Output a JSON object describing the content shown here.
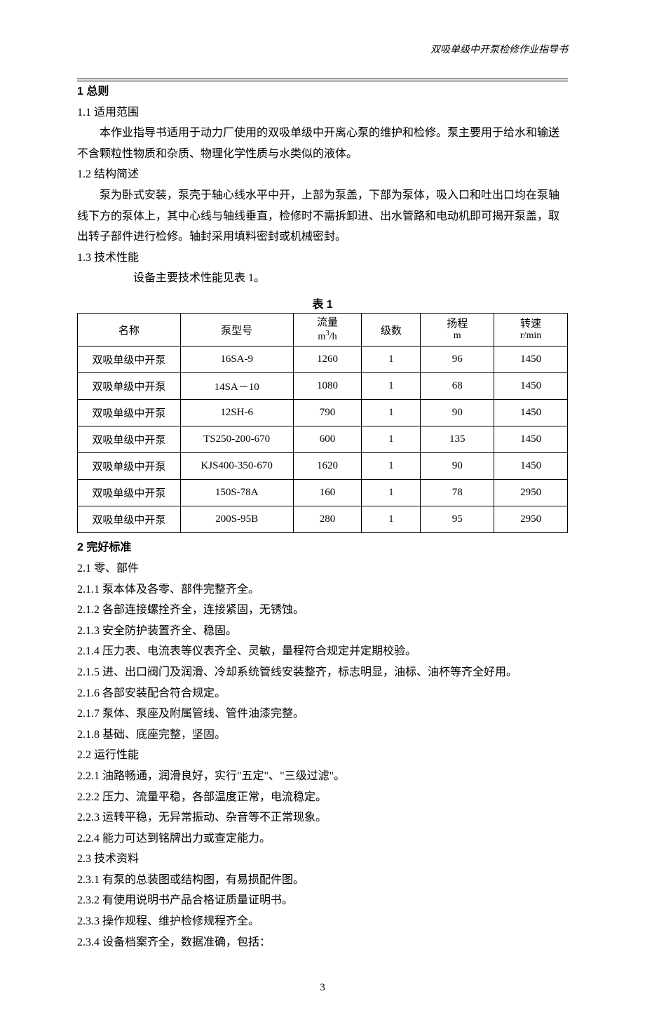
{
  "page_header": "双吸单级中开泵检修作业指导书",
  "sec1_title": "1  总则",
  "sec1_1_head": "1.1  适用范围",
  "sec1_1_p": "本作业指导书适用于动力厂使用的双吸单级中开离心泵的维护和检修。泵主要用于给水和输送不含颗粒性物质和杂质、物理化学性质与水类似的液体。",
  "sec1_2_head": "1.2  结构简述",
  "sec1_2_p": "泵为卧式安装，泵壳于轴心线水平中开，上部为泵盖，下部为泵体，吸入口和吐出口均在泵轴线下方的泵体上，其中心线与轴线垂直，检修时不需拆卸进、出水管路和电动机即可揭开泵盖，取出转子部件进行检修。轴封采用填料密封或机械密封。",
  "sec1_3_head": "1.3  技术性能",
  "sec1_3_p": "设备主要技术性能见表 1。",
  "table_caption": "表 1",
  "table": {
    "headers": {
      "name": "名称",
      "model": "泵型号",
      "flow_l1": "流量",
      "flow_l2_a": "m",
      "flow_l2_sup": "3",
      "flow_l2_b": "/h",
      "stages": "级数",
      "head_l1": "扬程",
      "head_l2": "m",
      "speed_l1": "转速",
      "speed_l2": "r/min"
    },
    "rows": [
      {
        "name": "双吸单级中开泵",
        "model": "16SA-9",
        "flow": "1260",
        "stages": "1",
        "head": "96",
        "speed": "1450"
      },
      {
        "name": "双吸单级中开泵",
        "model": "14SA－10",
        "flow": "1080",
        "stages": "1",
        "head": "68",
        "speed": "1450"
      },
      {
        "name": "双吸单级中开泵",
        "model": "12SH-6",
        "flow": "790",
        "stages": "1",
        "head": "90",
        "speed": "1450"
      },
      {
        "name": "双吸单级中开泵",
        "model": "TS250-200-670",
        "flow": "600",
        "stages": "1",
        "head": "135",
        "speed": "1450"
      },
      {
        "name": "双吸单级中开泵",
        "model": "KJS400-350-670",
        "flow": "1620",
        "stages": "1",
        "head": "90",
        "speed": "1450"
      },
      {
        "name": "双吸单级中开泵",
        "model": "150S-78A",
        "flow": "160",
        "stages": "1",
        "head": "78",
        "speed": "2950"
      },
      {
        "name": "双吸单级中开泵",
        "model": "200S-95B",
        "flow": "280",
        "stages": "1",
        "head": "95",
        "speed": "2950"
      }
    ]
  },
  "sec2_title": "2 完好标准",
  "sec2_1_head": "2.1  零、部件",
  "sec2_1": [
    "2.1.1  泵本体及各零、部件完整齐全。",
    "2.1.2  各部连接螺拴齐全，连接紧固，无锈蚀。",
    "2.1.3  安全防护装置齐全、稳固。",
    "2.1.4  压力表、电流表等仪表齐全、灵敏，量程符合规定并定期校验。",
    "2.1.5  进、出口阀门及润滑、冷却系统管线安装整齐，标志明显，油标、油杯等齐全好用。",
    "2.1.6  各部安装配合符合规定。",
    "2.1.7  泵体、泵座及附属管线、管件油漆完整。",
    "2.1.8  基础、底座完整，坚固。"
  ],
  "sec2_2_head": "2.2  运行性能",
  "sec2_2": [
    "2.2.1  油路畅通，润滑良好，实行\"五定\"、\"三级过滤\"。",
    "2.2.2  压力、流量平稳，各部温度正常，电流稳定。",
    "2.2.3  运转平稳，无异常振动、杂音等不正常现象。",
    "2.2.4  能力可达到铭牌出力或查定能力。"
  ],
  "sec2_3_head": "2.3  技术资料",
  "sec2_3": [
    "2.3.1  有泵的总装图或结构图，有易损配件图。",
    "2.3.2  有使用说明书产品合格证质量证明书。",
    "2.3.3  操作规程、维护检修规程齐全。",
    "2.3.4  设备档案齐全，数据准确，包括："
  ],
  "page_number": "3"
}
